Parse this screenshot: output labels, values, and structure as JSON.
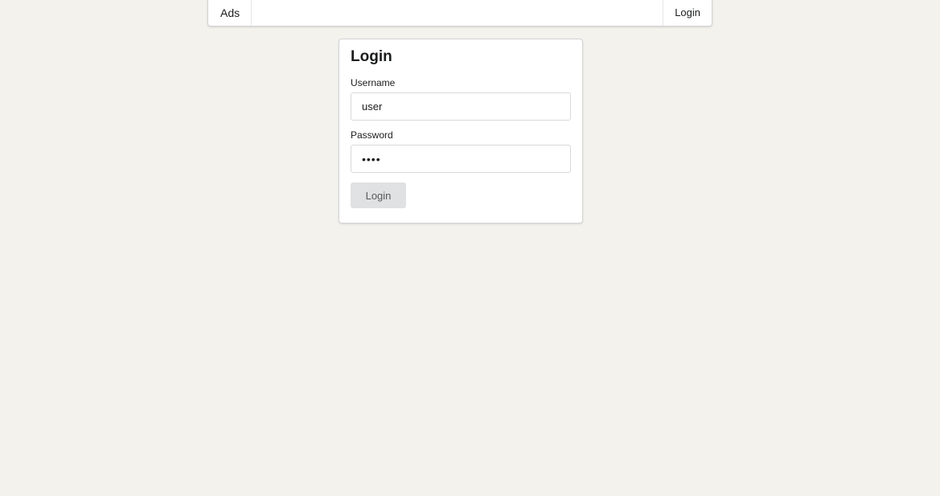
{
  "menu": {
    "left_item": "Ads",
    "right_item": "Login"
  },
  "login": {
    "title": "Login",
    "username_label": "Username",
    "username_value": "user",
    "password_label": "Password",
    "password_value": "1234",
    "submit_label": "Login"
  },
  "colors": {
    "background": "#f3f2ed",
    "button": "#e0e1e2"
  }
}
